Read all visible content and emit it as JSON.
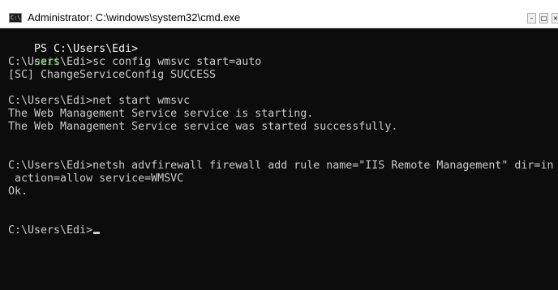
{
  "window": {
    "title": "Administrator: C:\\windows\\system32\\cmd.exe",
    "icon": "cmd-icon",
    "icon_text": "C:\\",
    "buttons": {
      "minimize": "–",
      "maximize": "□",
      "close": "×"
    }
  },
  "console": {
    "ps_prompt": "PS C:\\Users\\Edi>",
    "ps_command": "exit",
    "lines": [
      "C:\\Users\\Edi>sc config wmsvc start=auto",
      "[SC] ChangeServiceConfig SUCCESS",
      "C:\\Users\\Edi>net start wmsvc",
      "The Web Management Service service is starting.",
      "The Web Management Service service was started successfully.",
      "C:\\Users\\Edi>netsh advfirewall firewall add rule name=\"IIS Remote Management\" dir=in",
      " action=allow service=WMSVC",
      "Ok.",
      "C:\\Users\\Edi>"
    ]
  },
  "colors": {
    "console_bg": "#0c0c0c",
    "console_text": "#cccccc",
    "ps_arg": "#13a10e"
  }
}
